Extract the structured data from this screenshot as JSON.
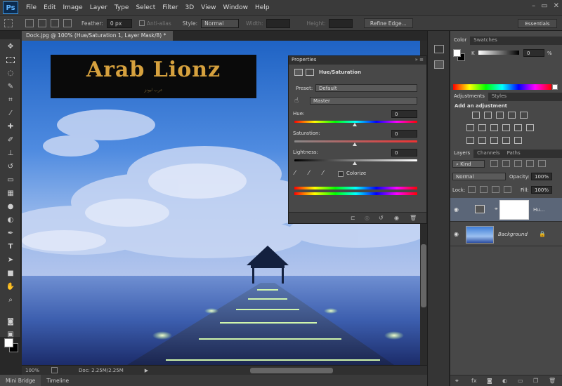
{
  "app": {
    "logo": "Ps"
  },
  "menu": [
    "File",
    "Edit",
    "Image",
    "Layer",
    "Type",
    "Select",
    "Filter",
    "3D",
    "View",
    "Window",
    "Help"
  ],
  "window_controls": [
    "–",
    "▭",
    "✕"
  ],
  "options_bar": {
    "feather_label": "Feather:",
    "feather_value": "0 px",
    "antialias_label": "Anti-alias",
    "style_label": "Style:",
    "style_value": "Normal",
    "width_label": "Width:",
    "height_label": "Height:",
    "refine_edge": "Refine Edge...",
    "workspace": "Essentials"
  },
  "document": {
    "tab_title": "Dock.jpg @ 100% (Hue/Saturation 1, Layer Mask/8) *",
    "zoom": "100%",
    "doc_size": "Doc: 2.25M/2.25M"
  },
  "logo_overlay": {
    "text": "Arab Lionz",
    "subtext": "عرب ليونز"
  },
  "properties": {
    "header": "Properties",
    "title": "Hue/Saturation",
    "preset_label": "Preset:",
    "preset_value": "Default",
    "channel_value": "Master",
    "hue_label": "Hue:",
    "hue_value": "0",
    "saturation_label": "Saturation:",
    "saturation_value": "0",
    "lightness_label": "Lightness:",
    "lightness_value": "0",
    "colorize_label": "Colorize"
  },
  "color_panel": {
    "tabs": [
      "Color",
      "Swatches"
    ],
    "k_label": "K",
    "k_value": "0",
    "percent": "%"
  },
  "adjustments_panel": {
    "tabs": [
      "Adjustments",
      "Styles"
    ],
    "heading": "Add an adjustment"
  },
  "layers_panel": {
    "tabs": [
      "Layers",
      "Channels",
      "Paths"
    ],
    "kind_value": "Kind",
    "blend_value": "Normal",
    "opacity_label": "Opacity:",
    "opacity_value": "100%",
    "lock_label": "Lock:",
    "fill_label": "Fill:",
    "fill_value": "100%",
    "layers": [
      {
        "name": "Hu..."
      },
      {
        "name": "Background"
      }
    ]
  },
  "bottom_tabs": [
    "Mini Bridge",
    "Timeline"
  ],
  "colors": {
    "ps_blue": "#3c8fd6",
    "logo_gold": "#d6a13e",
    "panel_bg": "#484848"
  }
}
